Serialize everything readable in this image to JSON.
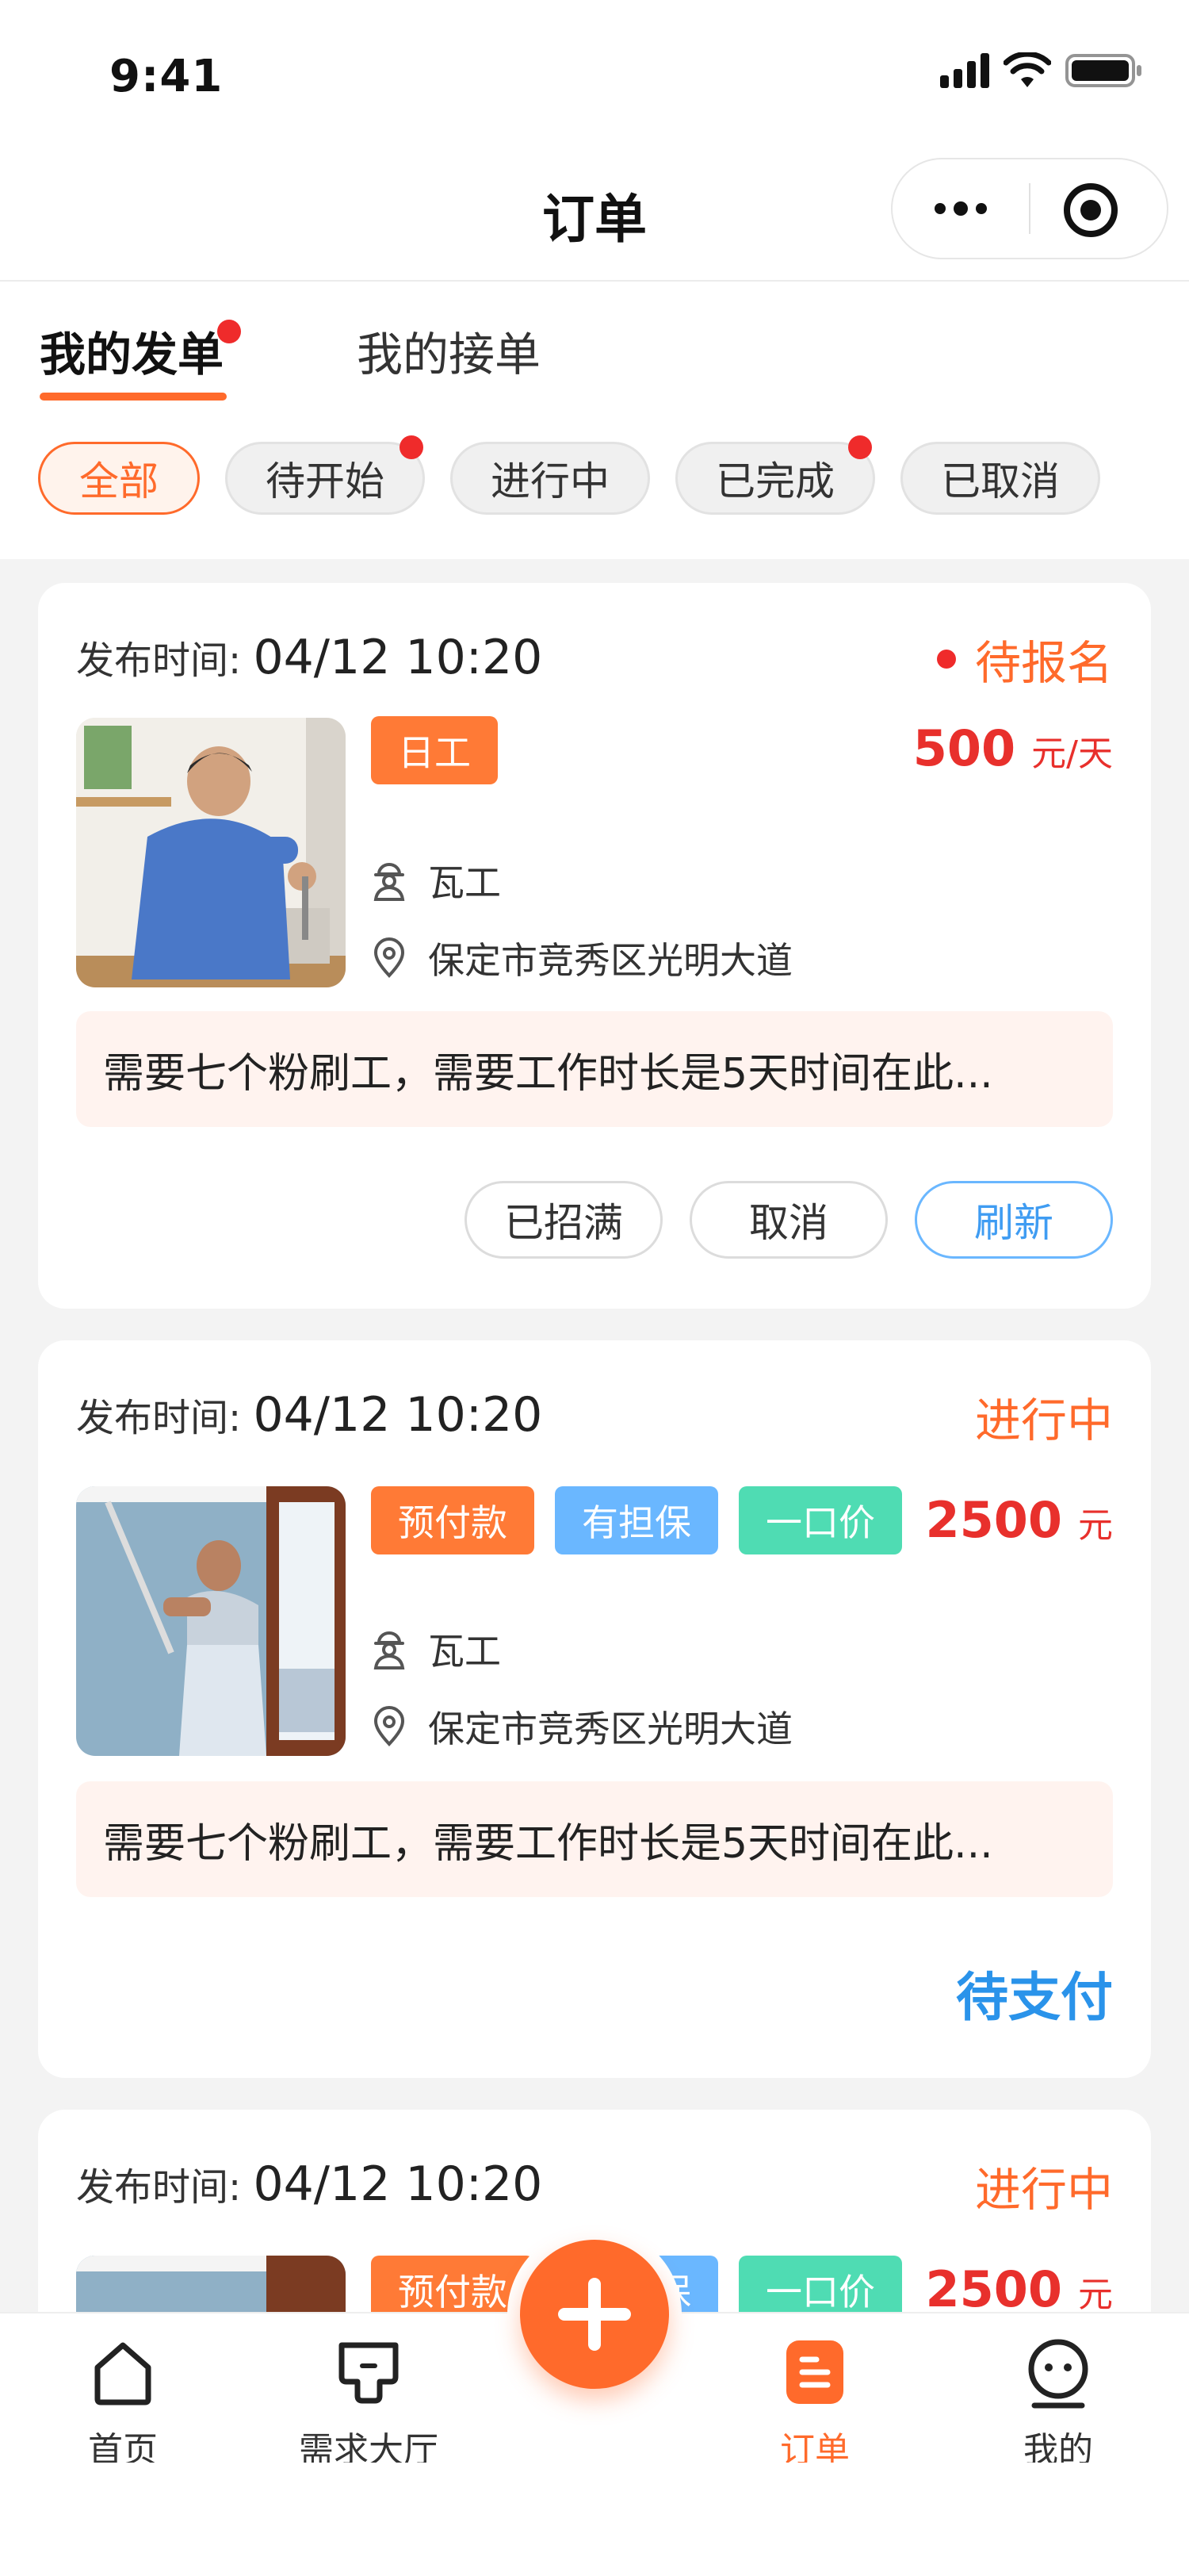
{
  "status_bar": {
    "time": "9:41"
  },
  "nav": {
    "title": "订单"
  },
  "tabs": [
    {
      "label": "我的发单",
      "active": true,
      "badge": true
    },
    {
      "label": "我的接单",
      "active": false,
      "badge": false
    }
  ],
  "filters": [
    {
      "label": "全部",
      "active": true,
      "badge": false
    },
    {
      "label": "待开始",
      "active": false,
      "badge": true
    },
    {
      "label": "进行中",
      "active": false,
      "badge": false
    },
    {
      "label": "已完成",
      "active": false,
      "badge": true
    },
    {
      "label": "已取消",
      "active": false,
      "badge": false
    }
  ],
  "orders": [
    {
      "time_label": "发布时间:",
      "time_value": "04/12 10:20",
      "status": "待报名",
      "tags": [
        "日工"
      ],
      "price": "500",
      "unit": "元/天",
      "work_type": "瓦工",
      "address": "保定市竞秀区光明大道",
      "description": "需要七个粉刷工，需要工作时长是5天时间在此...",
      "actions": [
        "已招满",
        "取消",
        "刷新"
      ]
    },
    {
      "time_label": "发布时间:",
      "time_value": "04/12 10:20",
      "status": "进行中",
      "tags": [
        "预付款",
        "有担保",
        "一口价"
      ],
      "price": "2500",
      "unit": "元",
      "work_type": "瓦工",
      "address": "保定市竞秀区光明大道",
      "description": "需要七个粉刷工，需要工作时长是5天时间在此...",
      "action_link": "待支付"
    },
    {
      "time_label": "发布时间:",
      "time_value": "04/12 10:20",
      "status": "进行中",
      "tags": [
        "预付款",
        "有担保",
        "一口价"
      ],
      "price": "2500",
      "unit": "元"
    }
  ],
  "tabbar": [
    {
      "label": "首页",
      "icon": "home-icon",
      "active": false
    },
    {
      "label": "需求大厅",
      "icon": "demand-hall-icon",
      "active": false
    },
    {
      "label": "订单",
      "icon": "orders-icon",
      "active": true
    },
    {
      "label": "我的",
      "icon": "profile-icon",
      "active": false
    }
  ],
  "colors": {
    "accent": "#ff6a2b",
    "price": "#e8302c",
    "blue": "#6ab7ff",
    "green": "#4fdcb3",
    "badge": "#ef2b2b",
    "link": "#2a93ea"
  }
}
